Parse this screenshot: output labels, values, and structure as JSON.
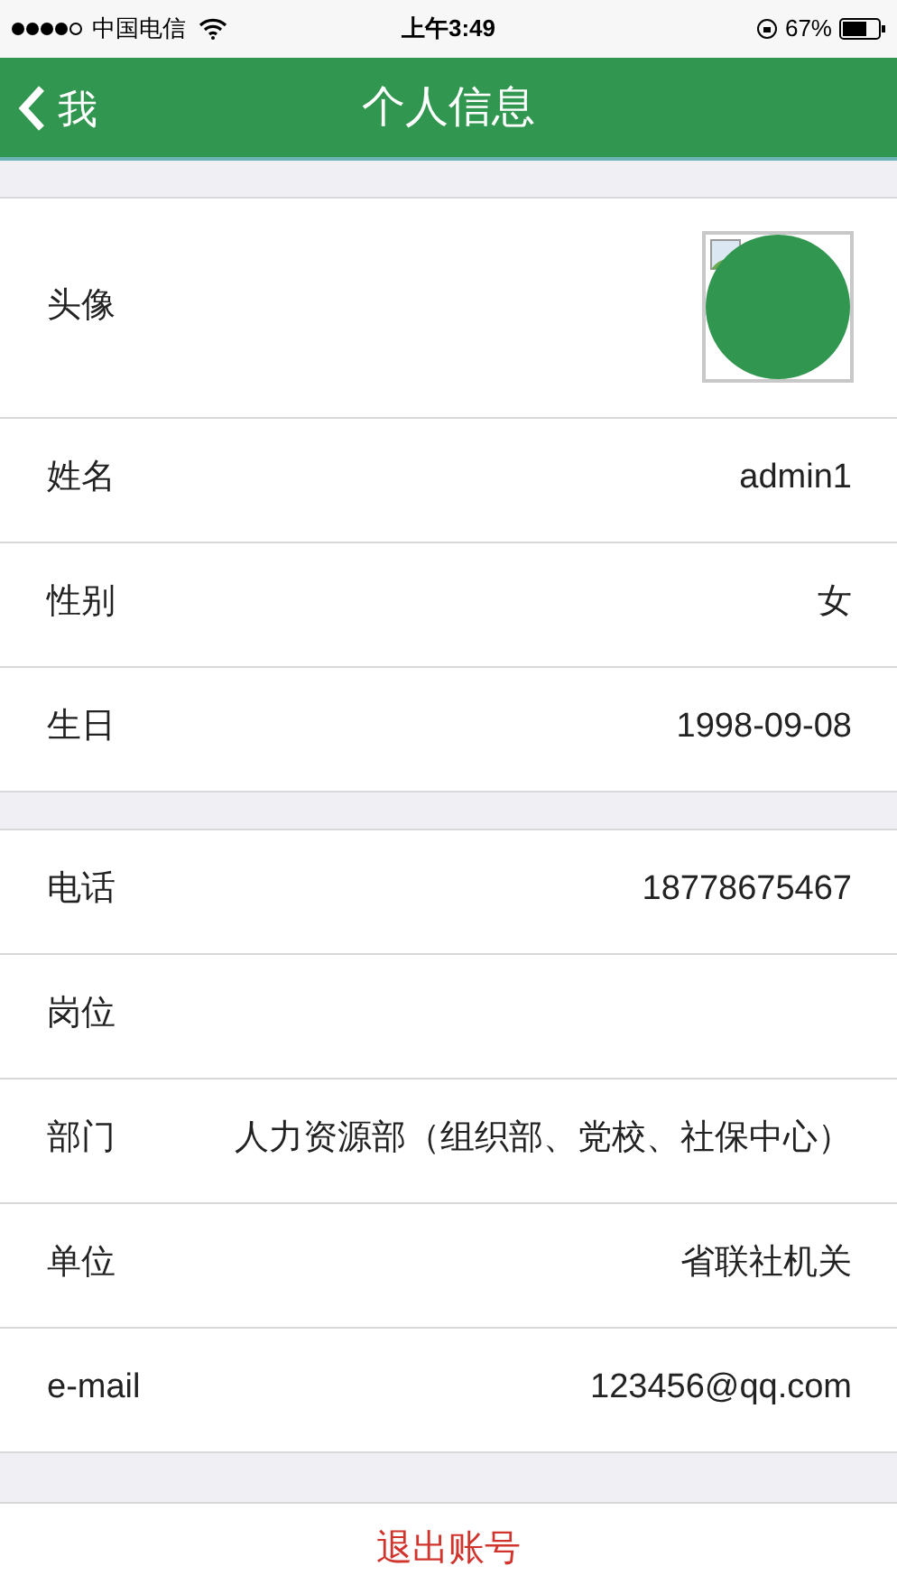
{
  "status_bar": {
    "carrier": "中国电信",
    "time": "上午3:49",
    "battery": "67%"
  },
  "nav_bar": {
    "back": "我",
    "title": "个人信息"
  },
  "avatar_row": {
    "label": "头像"
  },
  "sections": [
    {
      "rows": [
        {
          "label": "姓名",
          "value": "admin1"
        },
        {
          "label": "性别",
          "value": "女"
        },
        {
          "label": "生日",
          "value": "1998-09-08"
        }
      ]
    },
    {
      "rows": [
        {
          "label": "电话",
          "value": "18778675467"
        },
        {
          "label": "岗位"
        },
        {
          "label": "部门",
          "value": "人力资源部（组织部、党校、社保中心）"
        },
        {
          "label": "单位",
          "value": "省联社机关"
        },
        {
          "label": "e-mail",
          "value": "123456@qq.com"
        }
      ]
    }
  ],
  "logout": "退出账号"
}
